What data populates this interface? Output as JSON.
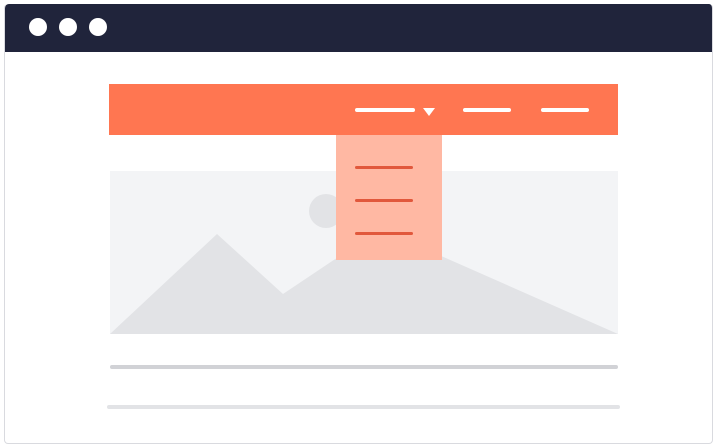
{
  "window": {
    "titlebar_color": "#20243b",
    "controls": [
      "close-dot",
      "minimize-dot",
      "maximize-dot"
    ]
  },
  "navbar": {
    "color": "#ff7651",
    "items": [
      {
        "name": "nav-item-dropdown",
        "has_caret": true
      },
      {
        "name": "nav-item-2"
      },
      {
        "name": "nav-item-3"
      }
    ]
  },
  "dropdown": {
    "state": "open",
    "background": "#ffb8a3",
    "item_color": "#e1583c",
    "item_count": 3
  },
  "hero": {
    "background": "#f3f4f6",
    "icon": "image-placeholder-icon"
  },
  "content": {
    "line_count": 2
  }
}
